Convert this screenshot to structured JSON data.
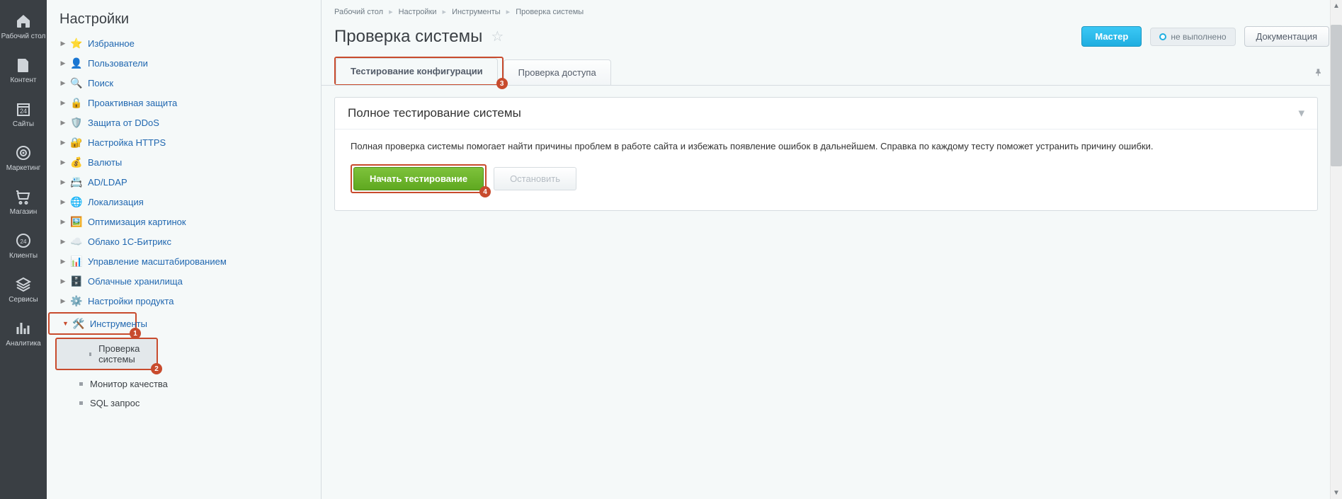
{
  "rail": [
    {
      "label": "Рабочий стол",
      "icon": "home"
    },
    {
      "label": "Контент",
      "icon": "doc"
    },
    {
      "label": "Сайты",
      "icon": "calendar"
    },
    {
      "label": "Маркетинг",
      "icon": "target"
    },
    {
      "label": "Магазин",
      "icon": "cart"
    },
    {
      "label": "Клиенты",
      "icon": "clients"
    },
    {
      "label": "Сервисы",
      "icon": "layers"
    },
    {
      "label": "Аналитика",
      "icon": "chart"
    }
  ],
  "sidebar": {
    "title": "Настройки",
    "items": [
      {
        "label": "Избранное",
        "icon": "⭐"
      },
      {
        "label": "Пользователи",
        "icon": "👤"
      },
      {
        "label": "Поиск",
        "icon": "🔍"
      },
      {
        "label": "Проактивная защита",
        "icon": "🔒"
      },
      {
        "label": "Защита от DDoS",
        "icon": "🛡️"
      },
      {
        "label": "Настройка HTTPS",
        "icon": "🔐"
      },
      {
        "label": "Валюты",
        "icon": "💰"
      },
      {
        "label": "AD/LDAP",
        "icon": "📇"
      },
      {
        "label": "Локализация",
        "icon": "🌐"
      },
      {
        "label": "Оптимизация картинок",
        "icon": "🖼️"
      },
      {
        "label": "Облако 1С-Битрикс",
        "icon": "☁️"
      },
      {
        "label": "Управление масштабированием",
        "icon": "📊"
      },
      {
        "label": "Облачные хранилища",
        "icon": "🗄️"
      },
      {
        "label": "Настройки продукта",
        "icon": "⚙️"
      }
    ],
    "instruments_label": "Инструменты",
    "instruments_icon": "🛠️",
    "children": [
      {
        "label": "Проверка системы"
      },
      {
        "label": "Монитор качества"
      },
      {
        "label": "SQL запрос"
      }
    ]
  },
  "breadcrumb": [
    "Рабочий стол",
    "Настройки",
    "Инструменты",
    "Проверка системы"
  ],
  "page": {
    "title": "Проверка системы",
    "master": "Мастер",
    "status": "не выполнено",
    "doc": "Документация"
  },
  "tabs": {
    "active": "Тестирование конфигурации",
    "other": "Проверка доступа"
  },
  "panel": {
    "title": "Полное тестирование системы",
    "text": "Полная проверка системы помогает найти причины проблем в работе сайта и избежать появление ошибок в дальнейшем. Справка по каждому тесту поможет устранить причину ошибки.",
    "start": "Начать тестирование",
    "stop": "Остановить"
  },
  "annot": {
    "n1": "1",
    "n2": "2",
    "n3": "3",
    "n4": "4"
  }
}
